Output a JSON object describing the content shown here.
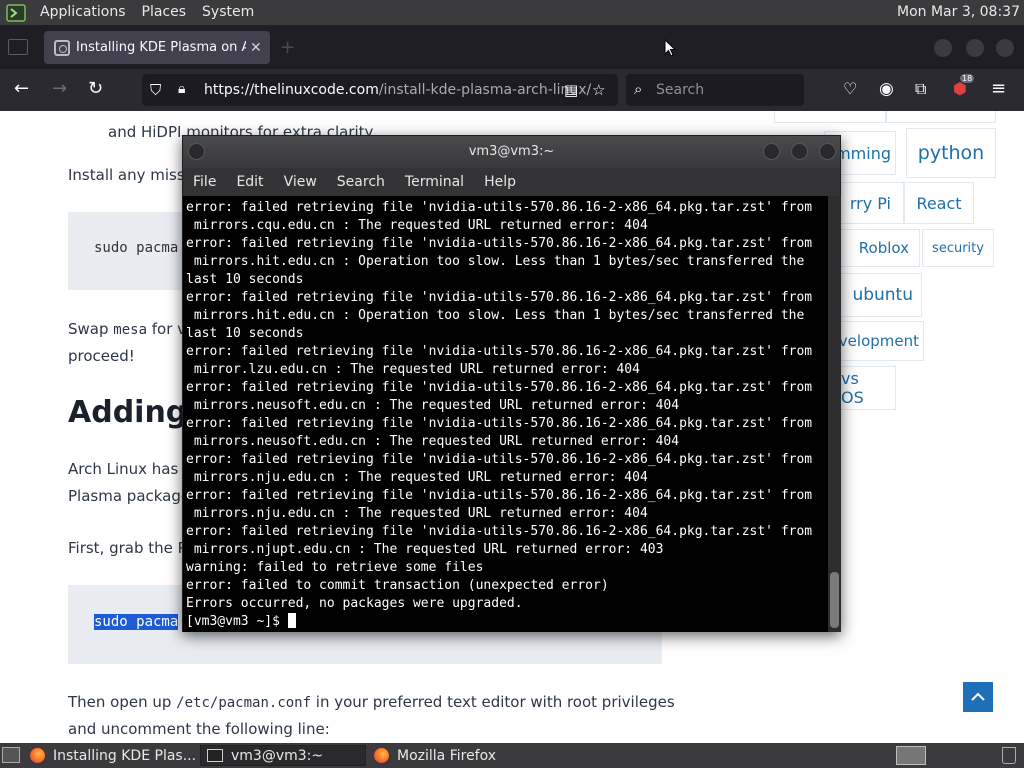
{
  "top_panel": {
    "menus": [
      "Applications",
      "Places",
      "System"
    ],
    "clock": "Mon Mar  3, 08:37"
  },
  "browser": {
    "tab_title": "Installing KDE Plasma on Ar",
    "tab_close": "✕",
    "url_domain": "https://thelinuxcode.com",
    "url_path": "/install-kde-plasma-arch-linux/",
    "search_placeholder": "Search",
    "extension_badge": "18"
  },
  "article": {
    "line1": "and HiDPI monitors for extra clarity.",
    "line2": "Install any missi",
    "code1": "sudo pacma",
    "swap_prefix": "Swap ",
    "swap_mono": "mesa",
    "swap_suffix": " for v",
    "proceed": "proceed!",
    "heading": "Adding",
    "arch_line1": "Arch Linux has a",
    "arch_line2": "Plasma package",
    "first_line": "First, grab the P",
    "code2": "sudo pacma",
    "then_prefix": "Then open up ",
    "then_mono": "/etc/pacman.conf",
    "then_suffix": " in your preferred text editor with root privileges",
    "uncomment": "and uncomment the following line:"
  },
  "sidebar_tags": [
    {
      "label": "mming"
    },
    {
      "label": "python"
    },
    {
      "label": "rry Pi"
    },
    {
      "label": "React"
    },
    {
      "label": "Roblox"
    },
    {
      "label": "security"
    },
    {
      "label": "ubuntu"
    },
    {
      "label": "velopment"
    },
    {
      "label": "vs OS"
    }
  ],
  "terminal": {
    "title": "vm3@vm3:~",
    "menu": [
      "File",
      "Edit",
      "View",
      "Search",
      "Terminal",
      "Help"
    ],
    "lines": [
      "error: failed retrieving file 'nvidia-utils-570.86.16-2-x86_64.pkg.tar.zst' from",
      " mirrors.cqu.edu.cn : The requested URL returned error: 404",
      "error: failed retrieving file 'nvidia-utils-570.86.16-2-x86_64.pkg.tar.zst' from",
      " mirrors.hit.edu.cn : Operation too slow. Less than 1 bytes/sec transferred the",
      "last 10 seconds",
      "error: failed retrieving file 'nvidia-utils-570.86.16-2-x86_64.pkg.tar.zst' from",
      " mirrors.hit.edu.cn : Operation too slow. Less than 1 bytes/sec transferred the",
      "last 10 seconds",
      "error: failed retrieving file 'nvidia-utils-570.86.16-2-x86_64.pkg.tar.zst' from",
      " mirror.lzu.edu.cn : The requested URL returned error: 404",
      "error: failed retrieving file 'nvidia-utils-570.86.16-2-x86_64.pkg.tar.zst' from",
      " mirrors.neusoft.edu.cn : The requested URL returned error: 404",
      "error: failed retrieving file 'nvidia-utils-570.86.16-2-x86_64.pkg.tar.zst' from",
      " mirrors.neusoft.edu.cn : The requested URL returned error: 404",
      "error: failed retrieving file 'nvidia-utils-570.86.16-2-x86_64.pkg.tar.zst' from",
      " mirrors.nju.edu.cn : The requested URL returned error: 404",
      "error: failed retrieving file 'nvidia-utils-570.86.16-2-x86_64.pkg.tar.zst' from",
      " mirrors.nju.edu.cn : The requested URL returned error: 404",
      "error: failed retrieving file 'nvidia-utils-570.86.16-2-x86_64.pkg.tar.zst' from",
      " mirrors.njupt.edu.cn : The requested URL returned error: 403",
      "warning: failed to retrieve some files",
      "error: failed to commit transaction (unexpected error)",
      "Errors occurred, no packages were upgraded."
    ],
    "prompt": "[vm3@vm3 ~]$ "
  },
  "taskbar": {
    "items": [
      "Installing KDE Plas...",
      "vm3@vm3:~",
      "Mozilla Firefox"
    ]
  }
}
